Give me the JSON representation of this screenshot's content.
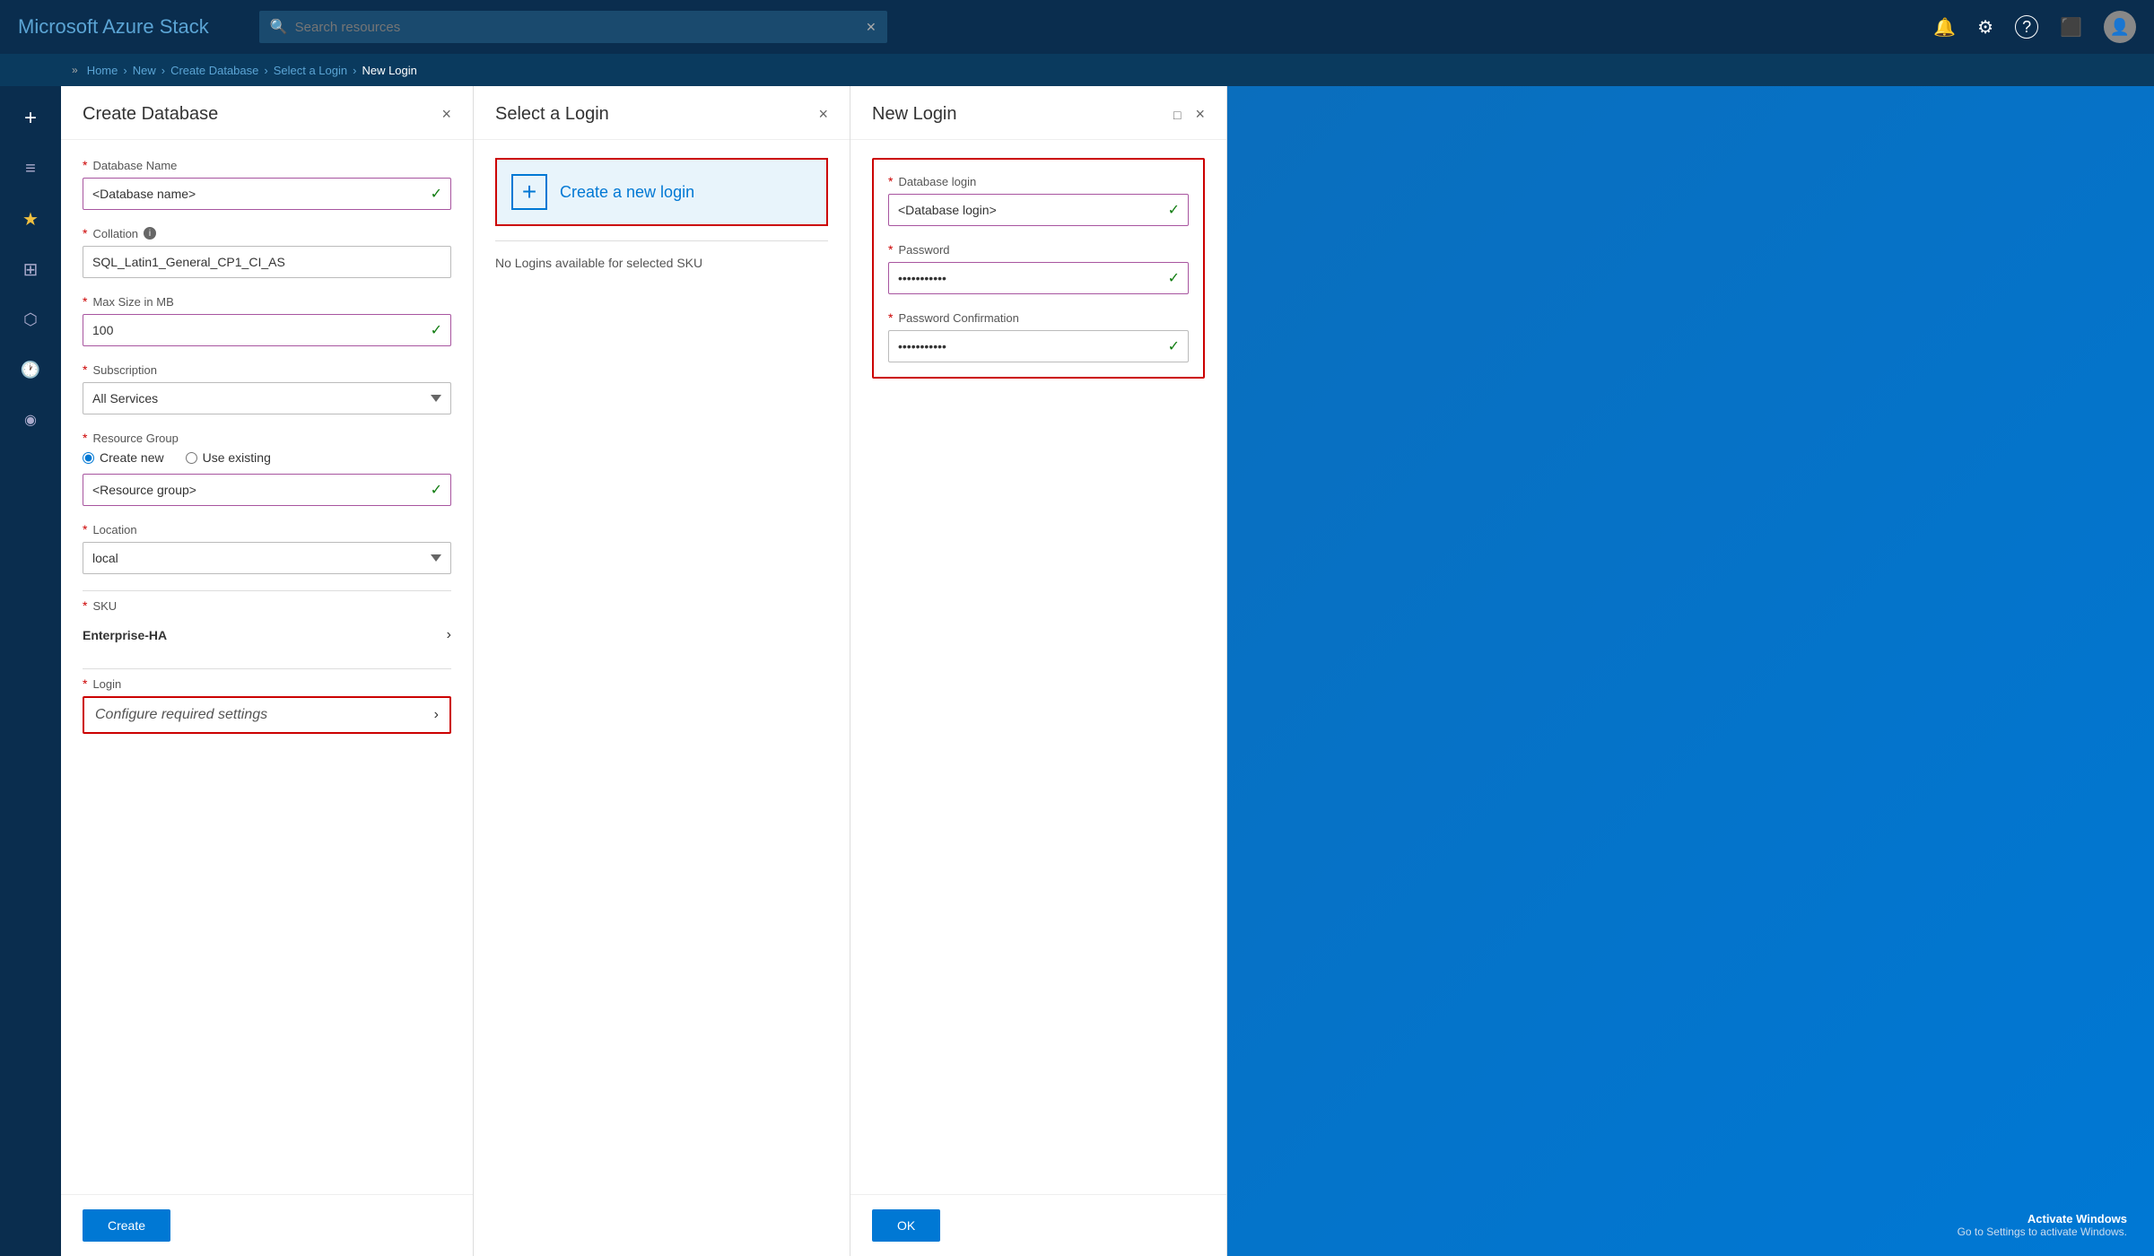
{
  "app": {
    "title": "Microsoft Azure Stack"
  },
  "topbar": {
    "title": "Microsoft Azure Stack",
    "search_placeholder": "Search resources",
    "close_label": "×"
  },
  "breadcrumb": {
    "items": [
      "Home",
      "New",
      "Create Database",
      "Select a Login",
      "New Login"
    ],
    "separators": [
      ">",
      ">",
      ">",
      ">"
    ]
  },
  "sidebar": {
    "items": [
      {
        "label": "+",
        "icon": "+"
      },
      {
        "label": "≡",
        "icon": "≡"
      },
      {
        "label": "★",
        "icon": "★"
      },
      {
        "label": "⊞",
        "icon": "⊞"
      },
      {
        "label": "⬡",
        "icon": "⬡"
      },
      {
        "label": "🕐",
        "icon": "🕐"
      },
      {
        "label": "◉",
        "icon": "◉"
      }
    ]
  },
  "panel1": {
    "title": "Create Database",
    "close_label": "×",
    "fields": {
      "database_name_label": "Database Name",
      "database_name_value": "<Database name>",
      "collation_label": "Collation",
      "collation_value": "SQL_Latin1_General_CP1_CI_AS",
      "max_size_label": "Max Size in MB",
      "max_size_value": "100",
      "subscription_label": "Subscription",
      "subscription_value": "All Services",
      "resource_group_label": "Resource Group",
      "resource_group_radio1": "Create new",
      "resource_group_radio2": "Use existing",
      "resource_group_value": "<Resource group>",
      "location_label": "Location",
      "location_value": "local",
      "sku_label": "SKU",
      "sku_value": "Enterprise-HA",
      "login_label": "Login",
      "login_value": "Configure required settings"
    },
    "create_button": "Create"
  },
  "panel2": {
    "title": "Select a Login",
    "close_label": "×",
    "create_login_label": "Create a new login",
    "no_logins_text": "No Logins available for selected SKU"
  },
  "panel3": {
    "title": "New Login",
    "close_label": "×",
    "maximize_label": "□",
    "fields": {
      "db_login_label": "Database login",
      "db_login_value": "<Database login>",
      "password_label": "Password",
      "password_value": "••••••••••••",
      "password_confirm_label": "Password Confirmation",
      "password_confirm_value": "••••••••••••"
    },
    "ok_button": "OK"
  },
  "icons": {
    "search": "🔍",
    "close": "✕",
    "bell": "🔔",
    "gear": "⚙",
    "question": "?",
    "portal": "⬛",
    "check": "✓",
    "chevron_right": "›",
    "chevron_down": "∨",
    "plus": "+"
  },
  "colors": {
    "azure_dark": "#0a2d4e",
    "azure_blue": "#0078d4",
    "required_red": "#cc0000",
    "check_green": "#107c10",
    "purple_border": "#a855a0"
  },
  "activate_windows": "Go to Settings to activate Windows.",
  "activate_title": "Activate Windows"
}
